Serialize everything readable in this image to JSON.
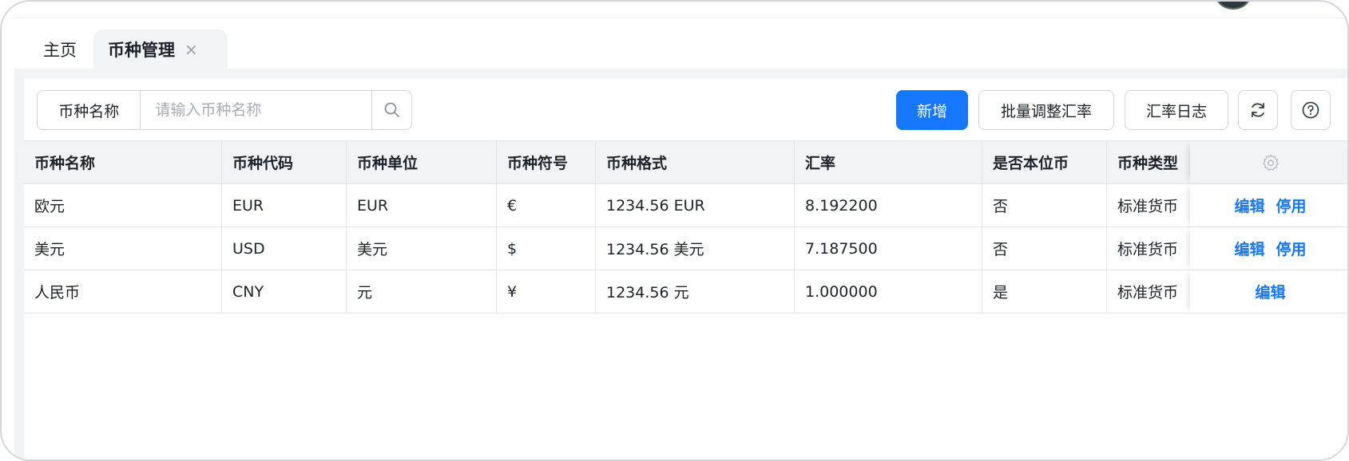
{
  "tabs": {
    "home": "主页",
    "active": "币种管理",
    "close": "×"
  },
  "toolbar": {
    "search_label": "币种名称",
    "search_placeholder": "请输入币种名称",
    "add_label": "新增",
    "batch_label": "批量调整汇率",
    "log_label": "汇率日志"
  },
  "table": {
    "columns": [
      "币种名称",
      "币种代码",
      "币种单位",
      "币种符号",
      "币种格式",
      "汇率",
      "是否本位币",
      "币种类型"
    ],
    "rows": [
      {
        "name": "欧元",
        "code": "EUR",
        "unit": "EUR",
        "symbol": "€",
        "format": "1234.56 EUR",
        "rate": "8.192200",
        "is_base": "否",
        "type": "标准货币",
        "actions": [
          "编辑",
          "停用"
        ]
      },
      {
        "name": "美元",
        "code": "USD",
        "unit": "美元",
        "symbol": "$",
        "format": "1234.56 美元",
        "rate": "7.187500",
        "is_base": "否",
        "type": "标准货币",
        "actions": [
          "编辑",
          "停用"
        ]
      },
      {
        "name": "人民币",
        "code": "CNY",
        "unit": "元",
        "symbol": "¥",
        "format": "1234.56 元",
        "rate": "1.000000",
        "is_base": "是",
        "type": "标准货币",
        "actions": [
          "编辑"
        ]
      }
    ]
  },
  "icons": {
    "search": "search-icon",
    "refresh": "refresh-icon",
    "help": "help-icon",
    "settings": "gear-icon"
  },
  "colors": {
    "primary": "#1677ff",
    "link": "#1677ff",
    "header_bg": "#f2f3f5"
  }
}
